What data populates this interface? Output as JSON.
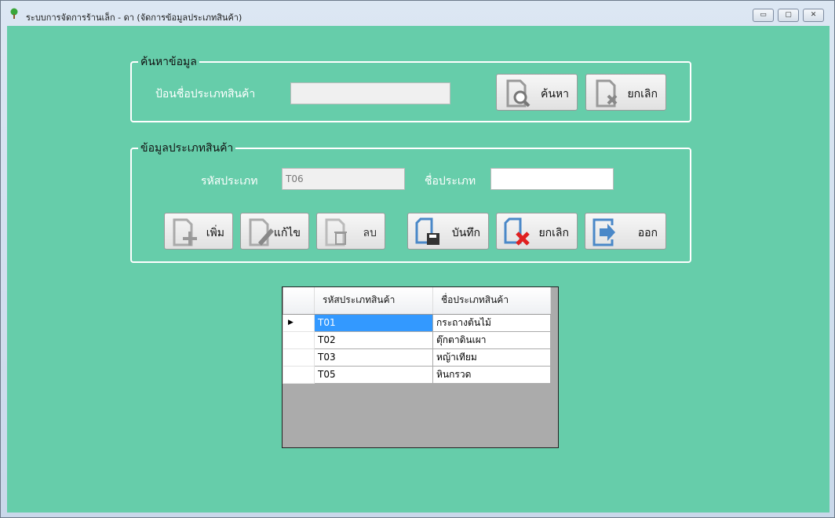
{
  "window": {
    "title": "ระบบการจัดการร้านเล็ก - ดา (จัดการข้อมูลประเภทสินค้า)",
    "minimize": "▭",
    "maximize": "▢",
    "close": "✕"
  },
  "search_group": {
    "legend": "ค้นหาข้อมูล",
    "label": "ป้อนชื่อประเภทสินค้า",
    "input_value": "",
    "search_button": "ค้นหา",
    "cancel_button": "ยกเลิก"
  },
  "info_group": {
    "legend": "ข้อมูลประเภทสินค้า",
    "code_label": "รหัสประเภท",
    "code_value": "T06",
    "name_label": "ชื่อประเภท",
    "name_value": "",
    "buttons": {
      "add": "เพิ่ม",
      "edit": "แก้ไข",
      "delete": "ลบ",
      "save": "บันทึก",
      "cancel": "ยกเลิก",
      "exit": "ออก"
    }
  },
  "grid": {
    "columns": [
      "รหัสประเภทสินค้า",
      "ชื่อประเภทสินค้า"
    ],
    "current_row_marker": "▶",
    "rows": [
      {
        "code": "T01",
        "name": "กระถางต้นไม้"
      },
      {
        "code": "T02",
        "name": "ตุ๊กตาดินเผา"
      },
      {
        "code": "T03",
        "name": "หญ้าเทียม"
      },
      {
        "code": "T05",
        "name": "หินกรวด"
      }
    ]
  },
  "colors": {
    "background": "#66cdaa",
    "selection": "#3399ff"
  }
}
